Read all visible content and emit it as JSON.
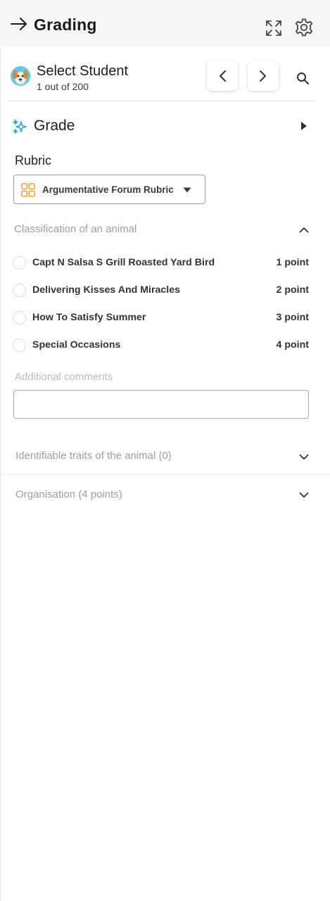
{
  "header": {
    "title": "Grading",
    "back_icon": "arrow-right-icon",
    "expand_icon": "expand-icon",
    "settings_icon": "gear-icon"
  },
  "student": {
    "name": "Select Student",
    "count": "1 out of 200",
    "avatar_icon": "dog-avatar"
  },
  "grade": {
    "label": "Grade",
    "icon": "sparkle-icon",
    "accent": "#2aa7d8"
  },
  "rubric": {
    "label": "Rubric",
    "selected": "Argumentative Forum Rubric",
    "icon": "grid-icon",
    "icon_color": "#f0a23a"
  },
  "criteria": [
    {
      "title": "Classification of an animal",
      "expanded": true,
      "options": [
        {
          "label": "Capt N Salsa S Grill Roasted Yard Bird",
          "points": "1 point"
        },
        {
          "label": "Delivering Kisses And Miracles",
          "points": "2 point"
        },
        {
          "label": "How To Satisfy Summer",
          "points": "3 point"
        },
        {
          "label": "Special Occasions",
          "points": "4 point"
        }
      ],
      "comments_label": "Additional comments",
      "comments_value": ""
    },
    {
      "title": "Identifiable traits of the animal (0)",
      "expanded": false
    },
    {
      "title": "Organisation (4 points)",
      "expanded": false
    }
  ]
}
